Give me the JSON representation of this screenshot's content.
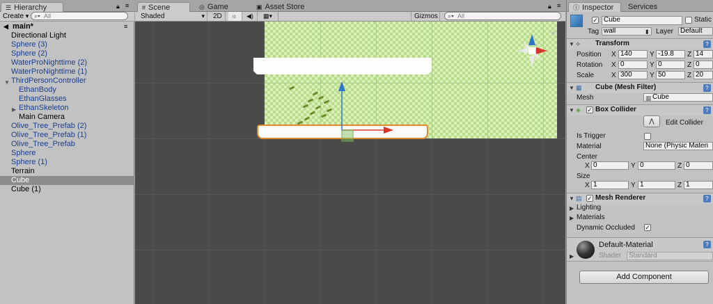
{
  "hierarchy": {
    "tab_label": "Hierarchy",
    "create_label": "Create",
    "search_placeholder": "All",
    "scene_name": "main*",
    "items": [
      {
        "label": "Directional Light",
        "indent": 16,
        "prefab": false,
        "selected": false,
        "arrow": false
      },
      {
        "label": "Sphere (3)",
        "indent": 16,
        "prefab": true,
        "selected": false,
        "arrow": false
      },
      {
        "label": "Sphere (2)",
        "indent": 16,
        "prefab": true,
        "selected": false,
        "arrow": false
      },
      {
        "label": "WaterProNighttime (2)",
        "indent": 16,
        "prefab": true,
        "selected": false,
        "arrow": false
      },
      {
        "label": "WaterProNighttime (1)",
        "indent": 16,
        "prefab": true,
        "selected": false,
        "arrow": false
      },
      {
        "label": "ThirdPersonController",
        "indent": 16,
        "prefab": true,
        "selected": false,
        "arrow": "down"
      },
      {
        "label": "EthanBody",
        "indent": 27,
        "prefab": true,
        "selected": false,
        "arrow": false
      },
      {
        "label": "EthanGlasses",
        "indent": 27,
        "prefab": true,
        "selected": false,
        "arrow": false
      },
      {
        "label": "EthanSkeleton",
        "indent": 27,
        "prefab": true,
        "selected": false,
        "arrow": "right"
      },
      {
        "label": "Main Camera",
        "indent": 27,
        "prefab": false,
        "selected": false,
        "arrow": false
      },
      {
        "label": "Olive_Tree_Prefab (2)",
        "indent": 16,
        "prefab": true,
        "selected": false,
        "arrow": false
      },
      {
        "label": "Olive_Tree_Prefab (1)",
        "indent": 16,
        "prefab": true,
        "selected": false,
        "arrow": false
      },
      {
        "label": "Olive_Tree_Prefab",
        "indent": 16,
        "prefab": true,
        "selected": false,
        "arrow": false
      },
      {
        "label": "Sphere",
        "indent": 16,
        "prefab": true,
        "selected": false,
        "arrow": false
      },
      {
        "label": "Sphere (1)",
        "indent": 16,
        "prefab": true,
        "selected": false,
        "arrow": false
      },
      {
        "label": "Terrain",
        "indent": 16,
        "prefab": false,
        "selected": false,
        "arrow": false
      },
      {
        "label": "Cube",
        "indent": 16,
        "prefab": false,
        "selected": true,
        "arrow": false
      },
      {
        "label": "Cube (1)",
        "indent": 16,
        "prefab": false,
        "selected": false,
        "arrow": false
      }
    ]
  },
  "scene": {
    "tabs": {
      "scene": "Scene",
      "game": "Game",
      "asset_store": "Asset Store"
    },
    "shading_mode": "Shaded",
    "mode_2d": "2D",
    "gizmos_label": "Gizmos",
    "search_placeholder": "All"
  },
  "inspector": {
    "tabs": {
      "inspector": "Inspector",
      "services": "Services"
    },
    "object_name": "Cube",
    "static_label": "Static",
    "tag_label": "Tag",
    "tag_value": "wall",
    "layer_label": "Layer",
    "layer_value": "Default",
    "transform": {
      "title": "Transform",
      "position_label": "Position",
      "rotation_label": "Rotation",
      "scale_label": "Scale",
      "position": {
        "x": "140",
        "y": "-19.8",
        "z": "14"
      },
      "rotation": {
        "x": "0",
        "y": "0",
        "z": "0"
      },
      "scale": {
        "x": "300",
        "y": "50",
        "z": "20"
      }
    },
    "mesh_filter": {
      "title": "Cube (Mesh Filter)",
      "mesh_label": "Mesh",
      "mesh_value": "Cube"
    },
    "box_collider": {
      "title": "Box Collider",
      "edit_label": "Edit Collider",
      "is_trigger_label": "Is Trigger",
      "material_label": "Material",
      "material_value": "None (Physic Materi",
      "center_label": "Center",
      "center": {
        "x": "0",
        "y": "0",
        "z": "0"
      },
      "size_label": "Size",
      "size": {
        "x": "1",
        "y": "1",
        "z": "1"
      }
    },
    "mesh_renderer": {
      "title": "Mesh Renderer",
      "lighting_label": "Lighting",
      "materials_label": "Materials",
      "dynamic_occluded_label": "Dynamic Occluded"
    },
    "material": {
      "name": "Default-Material",
      "shader_label": "Shader",
      "shader_value": "Standard"
    },
    "add_component_label": "Add Component",
    "axis_labels": {
      "x": "X",
      "y": "Y",
      "z": "Z"
    }
  },
  "colors": {
    "selection_outline": "#e0892c",
    "prefab_text": "#1a3e8c",
    "terrain_grass": "#d8efb5",
    "gizmo_x": "#d9342b",
    "gizmo_y": "#2d77c8"
  }
}
